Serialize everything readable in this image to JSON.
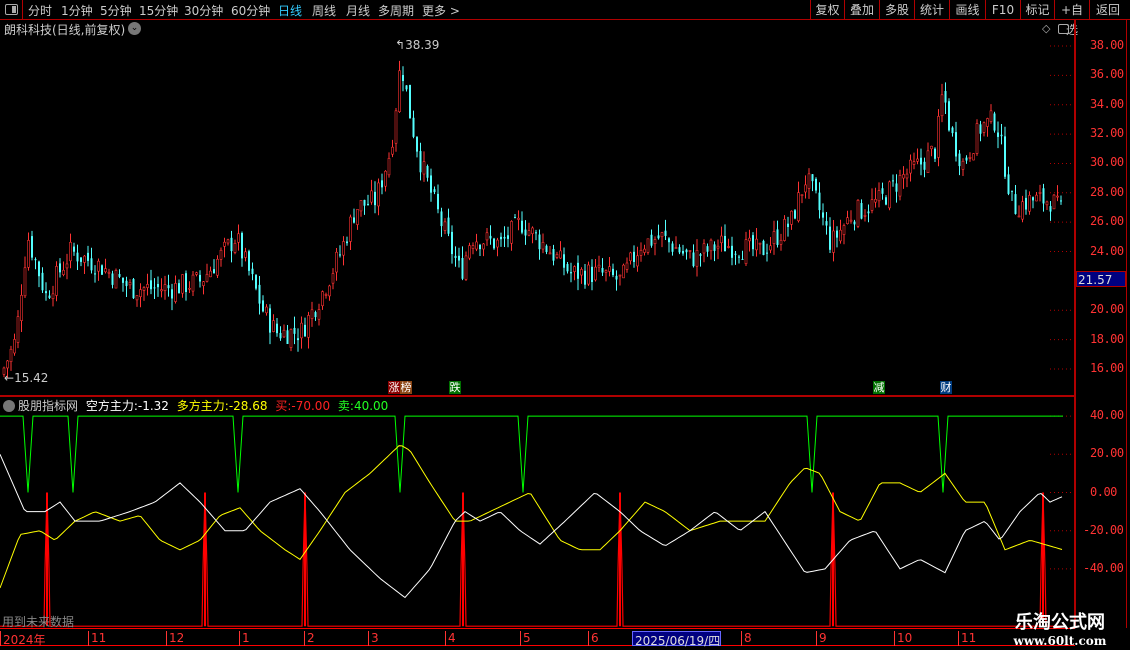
{
  "toolbar": {
    "periods": [
      "分时",
      "1分钟",
      "5分钟",
      "15分钟",
      "30分钟",
      "60分钟",
      "日线",
      "周线",
      "月线",
      "多周期",
      "更多 >"
    ],
    "active_period": "日线",
    "buttons": [
      "复权",
      "叠加",
      "多股",
      "统计",
      "画线",
      "F10",
      "标记",
      "+自选",
      "返回"
    ]
  },
  "title": "朗科科技(日线,前复权)",
  "price_axis": {
    "ticks": [
      "38.00",
      "36.00",
      "34.00",
      "32.00",
      "30.00",
      "28.00",
      "26.00",
      "24.00",
      "20.00",
      "18.00",
      "16.00"
    ],
    "current_price": "21.57"
  },
  "annotations": {
    "high": "38.39",
    "low": "15.42"
  },
  "markers": [
    {
      "text": "涨",
      "color": "#8b0000"
    },
    {
      "text": "榜",
      "color": "#8b4513"
    },
    {
      "text": "跌",
      "color": "#007000"
    },
    {
      "text": "减",
      "color": "#007000"
    },
    {
      "text": "财",
      "color": "#003c80"
    }
  ],
  "indicator": {
    "name": "股朋指标网",
    "kong_label": "空方主力:",
    "kong_value": "-1.32",
    "duo_label": "多方主力:",
    "duo_value": "-28.68",
    "buy_label": "买:",
    "buy_value": "-70.00",
    "sell_label": "卖:",
    "sell_value": "40.00",
    "ticks": [
      "40.00",
      "20.00",
      "0.00",
      "-20.00",
      "-40.00"
    ],
    "future_note": "用到未来数据"
  },
  "dates": [
    "2024年",
    "11",
    "12",
    "1",
    "2",
    "3",
    "4",
    "5",
    "6",
    "2025/06/19/四",
    "8",
    "9",
    "10",
    "11"
  ],
  "logo": {
    "name": "乐淘公式网",
    "url": "www.60lt.com"
  },
  "colors": {
    "up": "#ff3333",
    "down": "#54ffff",
    "kong": "#ffffff",
    "duo": "#ffff00",
    "buy": "#ff0000",
    "sell": "#00ff00",
    "axis": "#b00000"
  },
  "chart_data": {
    "type": "candlestick+line",
    "price_path": [
      [
        0,
        15.6
      ],
      [
        15,
        18
      ],
      [
        22,
        22.5
      ],
      [
        27,
        25
      ],
      [
        45,
        21
      ],
      [
        70,
        24
      ],
      [
        100,
        23
      ],
      [
        130,
        21.5
      ],
      [
        170,
        21.5
      ],
      [
        200,
        22
      ],
      [
        235,
        25
      ],
      [
        262,
        20
      ],
      [
        275,
        18.5
      ],
      [
        300,
        18.5
      ],
      [
        320,
        21
      ],
      [
        340,
        24
      ],
      [
        355,
        27
      ],
      [
        375,
        27.5
      ],
      [
        390,
        31
      ],
      [
        400,
        37
      ],
      [
        410,
        33
      ],
      [
        420,
        30
      ],
      [
        440,
        26
      ],
      [
        460,
        22.5
      ],
      [
        470,
        25
      ],
      [
        500,
        24.5
      ],
      [
        520,
        26
      ],
      [
        550,
        24
      ],
      [
        570,
        22.5
      ],
      [
        600,
        22.5
      ],
      [
        620,
        22
      ],
      [
        640,
        24.5
      ],
      [
        660,
        25
      ],
      [
        690,
        23.5
      ],
      [
        720,
        24.5
      ],
      [
        760,
        24
      ],
      [
        790,
        26
      ],
      [
        805,
        29
      ],
      [
        815,
        27.5
      ],
      [
        830,
        24.5
      ],
      [
        850,
        26.5
      ],
      [
        880,
        27.5
      ],
      [
        900,
        29
      ],
      [
        920,
        30
      ],
      [
        935,
        31
      ],
      [
        942,
        35
      ],
      [
        950,
        32
      ],
      [
        962,
        30
      ],
      [
        980,
        32.5
      ],
      [
        995,
        33
      ],
      [
        1005,
        29.5
      ],
      [
        1012,
        27
      ],
      [
        1030,
        27.5
      ],
      [
        1050,
        27.5
      ],
      [
        1063,
        26.5
      ]
    ],
    "kong_path": [
      [
        0,
        20
      ],
      [
        25,
        -10
      ],
      [
        45,
        -10
      ],
      [
        60,
        -5
      ],
      [
        75,
        -15
      ],
      [
        100,
        -15
      ],
      [
        130,
        -10
      ],
      [
        155,
        -5
      ],
      [
        180,
        5
      ],
      [
        200,
        -5
      ],
      [
        225,
        -20
      ],
      [
        245,
        -20
      ],
      [
        270,
        -5
      ],
      [
        300,
        2
      ],
      [
        320,
        -10
      ],
      [
        350,
        -30
      ],
      [
        380,
        -45
      ],
      [
        405,
        -55
      ],
      [
        430,
        -40
      ],
      [
        455,
        -15
      ],
      [
        465,
        -10
      ],
      [
        480,
        -15
      ],
      [
        500,
        -10
      ],
      [
        520,
        -20
      ],
      [
        540,
        -27
      ],
      [
        565,
        -15
      ],
      [
        595,
        0
      ],
      [
        620,
        -10
      ],
      [
        640,
        -20
      ],
      [
        665,
        -28
      ],
      [
        690,
        -20
      ],
      [
        715,
        -10
      ],
      [
        740,
        -20
      ],
      [
        765,
        -10
      ],
      [
        790,
        -30
      ],
      [
        805,
        -42
      ],
      [
        825,
        -40
      ],
      [
        850,
        -25
      ],
      [
        875,
        -20
      ],
      [
        900,
        -40
      ],
      [
        920,
        -35
      ],
      [
        945,
        -42
      ],
      [
        965,
        -20
      ],
      [
        985,
        -15
      ],
      [
        1000,
        -25
      ],
      [
        1020,
        -10
      ],
      [
        1040,
        0
      ],
      [
        1050,
        -5
      ],
      [
        1063,
        -2
      ]
    ],
    "duo_path": [
      [
        0,
        -50
      ],
      [
        20,
        -22
      ],
      [
        40,
        -20
      ],
      [
        55,
        -25
      ],
      [
        75,
        -15
      ],
      [
        95,
        -10
      ],
      [
        120,
        -15
      ],
      [
        140,
        -12
      ],
      [
        160,
        -25
      ],
      [
        180,
        -30
      ],
      [
        200,
        -25
      ],
      [
        220,
        -12
      ],
      [
        240,
        -8
      ],
      [
        260,
        -20
      ],
      [
        285,
        -30
      ],
      [
        300,
        -35
      ],
      [
        320,
        -20
      ],
      [
        345,
        0
      ],
      [
        370,
        10
      ],
      [
        400,
        25
      ],
      [
        410,
        22
      ],
      [
        430,
        5
      ],
      [
        455,
        -15
      ],
      [
        470,
        -15
      ],
      [
        490,
        -10
      ],
      [
        510,
        -5
      ],
      [
        530,
        0
      ],
      [
        560,
        -25
      ],
      [
        580,
        -30
      ],
      [
        600,
        -30
      ],
      [
        620,
        -20
      ],
      [
        645,
        -5
      ],
      [
        665,
        -10
      ],
      [
        690,
        -20
      ],
      [
        720,
        -15
      ],
      [
        765,
        -15
      ],
      [
        790,
        5
      ],
      [
        805,
        13
      ],
      [
        820,
        10
      ],
      [
        840,
        -10
      ],
      [
        860,
        -15
      ],
      [
        880,
        5
      ],
      [
        900,
        5
      ],
      [
        920,
        0
      ],
      [
        945,
        10
      ],
      [
        965,
        -5
      ],
      [
        985,
        -5
      ],
      [
        1005,
        -30
      ],
      [
        1030,
        -25
      ],
      [
        1050,
        -28
      ],
      [
        1063,
        -30
      ]
    ],
    "sell_dips": [
      28,
      73,
      238,
      400,
      523,
      812,
      943
    ],
    "buy_spikes": [
      47,
      205,
      305,
      463,
      620,
      833,
      1043
    ],
    "price_range": [
      15,
      39
    ],
    "indicator_range": [
      -70,
      45
    ]
  }
}
